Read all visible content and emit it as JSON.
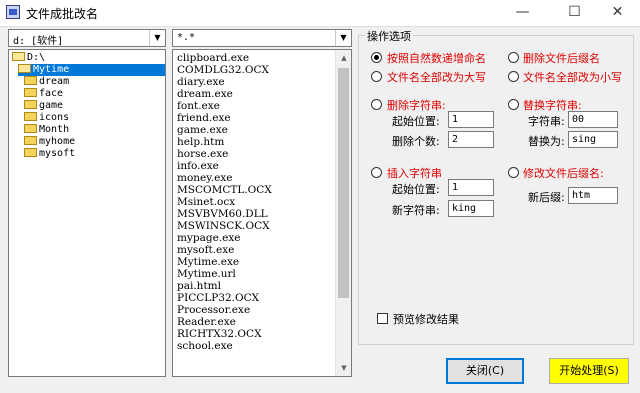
{
  "window": {
    "title": "文件成批改名",
    "minimize_glyph": "—",
    "maximize_glyph": "☐",
    "close_glyph": "✕"
  },
  "drive_combo": {
    "value": "d: [软件]",
    "arrow": "▼"
  },
  "directories": [
    {
      "name": "D:\\",
      "level": 0,
      "open": true,
      "selected": false
    },
    {
      "name": "Mytime",
      "level": 1,
      "open": true,
      "selected": true
    },
    {
      "name": "dream",
      "level": 2,
      "open": false,
      "selected": false
    },
    {
      "name": "face",
      "level": 2,
      "open": false,
      "selected": false
    },
    {
      "name": "game",
      "level": 2,
      "open": false,
      "selected": false
    },
    {
      "name": "icons",
      "level": 2,
      "open": false,
      "selected": false
    },
    {
      "name": "Month",
      "level": 2,
      "open": false,
      "selected": false
    },
    {
      "name": "myhome",
      "level": 2,
      "open": false,
      "selected": false
    },
    {
      "name": "mysoft",
      "level": 2,
      "open": false,
      "selected": false
    }
  ],
  "filter_combo": {
    "value": "*.*",
    "arrow": "▼"
  },
  "files": [
    "clipboard.exe",
    "COMDLG32.OCX",
    "diary.exe",
    "dream.exe",
    "font.exe",
    "friend.exe",
    "game.exe",
    "help.htm",
    "horse.exe",
    "info.exe",
    "money.exe",
    "MSCOMCTL.OCX",
    "Msinet.ocx",
    "MSVBVM60.DLL",
    "MSWINSCK.OCX",
    "mypage.exe",
    "mysoft.exe",
    "Mytime.exe",
    "Mytime.url",
    "pai.html",
    "PICCLP32.OCX",
    "Processor.exe",
    "Reader.exe",
    "RICHTX32.OCX",
    "school.exe"
  ],
  "scrollbar": {
    "up_arrow": "▲",
    "down_arrow": "▼"
  },
  "options": {
    "group_title": "操作选项",
    "natural_order": "按照自然数递增命名",
    "delete_ext": "删除文件后缀名",
    "to_upper": "文件名全部改为大写",
    "to_lower": "文件名全部改为小写",
    "delete_string": {
      "label": "删除字符串:",
      "start_label": "起始位置:",
      "start_value": "1",
      "count_label": "删除个数:",
      "count_value": "2"
    },
    "replace_string": {
      "label": "替换字符串:",
      "find_label": "字符串:",
      "find_value": "00",
      "replace_label": "替换为:",
      "replace_value": "sing"
    },
    "insert_string": {
      "label": "插入字符串",
      "start_label": "起始位置:",
      "start_value": "1",
      "new_label": "新字符串:",
      "new_value": "king"
    },
    "change_ext": {
      "label": "修改文件后缀名:",
      "new_label": "新后缀:",
      "new_value": "htm"
    },
    "selected": "natural_order"
  },
  "preview": {
    "label": "预览修改结果",
    "checked": false
  },
  "buttons": {
    "close": "关闭(C)",
    "start": "开始处理(S)"
  },
  "colors": {
    "option_label": "#e00000",
    "selection": "#0078d7",
    "start_button": "#ffff00"
  }
}
